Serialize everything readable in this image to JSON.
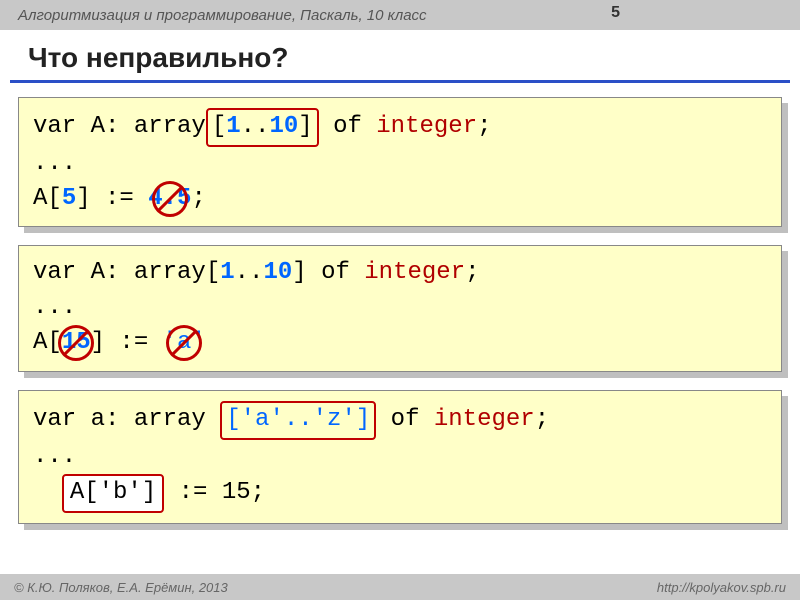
{
  "header": {
    "subject": "Алгоритмизация и программирование, Паскаль, 10 класс",
    "page_number": "5"
  },
  "title": "Что неправильно?",
  "blocks": [
    {
      "line1": {
        "p1": "var A: array",
        "range_open": "[",
        "range_lo": "1",
        "range_dots": "..",
        "range_hi": "10",
        "range_close": "]",
        "p2": " of ",
        "type": "integer",
        "p3": ";"
      },
      "line2": "...",
      "line3": {
        "p1": "A[",
        "idx": "5",
        "p2": "] := ",
        "val": "4.5",
        "p3": ";"
      }
    },
    {
      "line1": {
        "p1": "var A: array[",
        "lo": "1",
        "dots": "..",
        "hi": "10",
        "p2": "] of ",
        "type": "integer",
        "p3": ";"
      },
      "line2": "...",
      "line3": {
        "p1": "A[",
        "idx": "15",
        "p2": "] := ",
        "val": "'a'"
      }
    },
    {
      "line1": {
        "p1": "var a: array ",
        "range": "['a'..'z']",
        "p2": " of ",
        "type": "integer",
        "p3": ";"
      },
      "line2": "...",
      "line3": {
        "lhs": "A['b']",
        "rest": " := 15;"
      }
    }
  ],
  "footer": {
    "authors": "© К.Ю. Поляков, Е.А. Ерёмин, 2013",
    "url": "http://kpolyakov.spb.ru"
  }
}
